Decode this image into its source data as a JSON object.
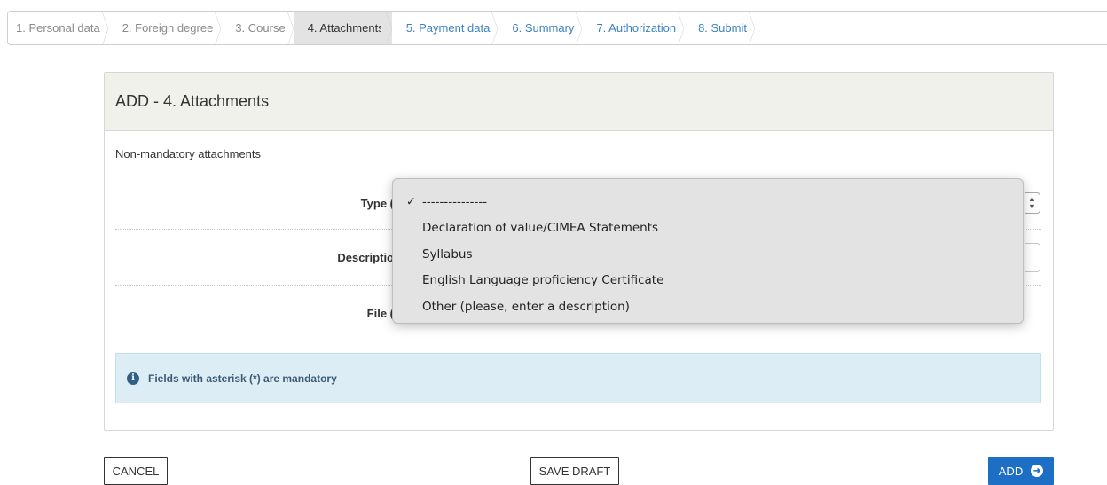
{
  "wizard": {
    "steps": [
      {
        "label": "1. Personal data"
      },
      {
        "label": "2. Foreign degree"
      },
      {
        "label": "3. Course"
      },
      {
        "label": "4. Attachments"
      },
      {
        "label": "5. Payment data"
      },
      {
        "label": "6. Summary"
      },
      {
        "label": "7. Authorization"
      },
      {
        "label": "8. Submit"
      }
    ],
    "active_index": 3
  },
  "panel": {
    "title": "ADD - 4. Attachments",
    "subtitle": "Non-mandatory attachments",
    "fields": {
      "type_label": "Type (",
      "description_label": "Descriptio",
      "file_label": "File ("
    },
    "info": "Fields with asterisk (*) are mandatory"
  },
  "dropdown": {
    "selected": "---------------",
    "options": [
      "---------------",
      "Declaration of value/CIMEA Statements",
      "Syllabus",
      "English Language proficiency Certificate",
      "Other (please, enter a description)"
    ]
  },
  "buttons": {
    "cancel": "CANCEL",
    "save_draft": "SAVE DRAFT",
    "add": "ADD"
  },
  "colors": {
    "accent": "#1d6fc5",
    "info_bg": "#dcedf6",
    "future_step": "#3b82c4"
  }
}
